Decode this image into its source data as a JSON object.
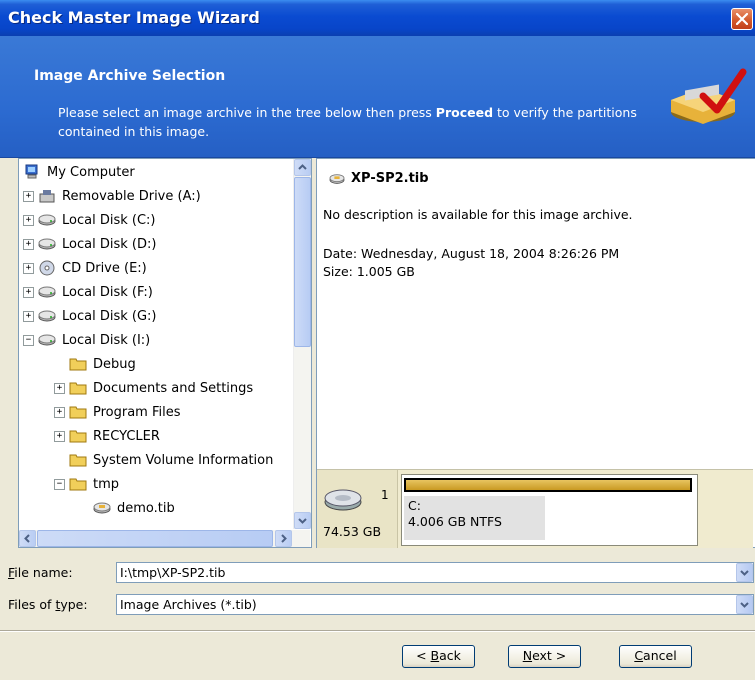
{
  "window": {
    "title": "Check Master Image Wizard"
  },
  "header": {
    "heading": "Image Archive Selection",
    "desc_pre": "Please select an image archive in the tree below then press ",
    "desc_bold": "Proceed",
    "desc_post": " to verify the partitions contained in this image."
  },
  "tree": {
    "items": [
      {
        "label": "My Computer",
        "icon": "computer-icon"
      },
      {
        "label": "Removable Drive (A:)",
        "icon": "removable-drive-icon",
        "expander": "+"
      },
      {
        "label": "Local Disk (C:)",
        "icon": "hard-disk-icon",
        "expander": "+"
      },
      {
        "label": "Local Disk (D:)",
        "icon": "hard-disk-icon",
        "expander": "+"
      },
      {
        "label": "CD Drive (E:)",
        "icon": "cd-drive-icon",
        "expander": "+"
      },
      {
        "label": "Local Disk (F:)",
        "icon": "hard-disk-icon",
        "expander": "+"
      },
      {
        "label": "Local Disk (G:)",
        "icon": "hard-disk-icon",
        "expander": "+"
      },
      {
        "label": "Local Disk (I:)",
        "icon": "hard-disk-icon",
        "expander": "−"
      },
      {
        "label": "Debug",
        "icon": "folder-icon"
      },
      {
        "label": "Documents and Settings",
        "icon": "folder-icon",
        "expander": "+"
      },
      {
        "label": "Program Files",
        "icon": "folder-icon",
        "expander": "+"
      },
      {
        "label": "RECYCLER",
        "icon": "folder-icon",
        "expander": "+"
      },
      {
        "label": "System Volume Information",
        "icon": "folder-icon"
      },
      {
        "label": "tmp",
        "icon": "folder-icon",
        "expander": "−"
      },
      {
        "label": "demo.tib",
        "icon": "image-archive-icon"
      }
    ]
  },
  "details": {
    "file_name": "XP-SP2.tib",
    "description": "No description is available for this image archive.",
    "date": "Date: Wednesday, August 18, 2004 8:26:26 PM",
    "size": "Size: 1.005 GB",
    "disk_number": "1",
    "disk_size": "74.53 GB",
    "partition_letter": "C:",
    "partition_info": "4.006 GB  NTFS"
  },
  "form": {
    "file_name_label_pre": "",
    "file_name_label_u": "F",
    "file_name_label_post": "ile name:",
    "file_name_value": "I:\\tmp\\XP-SP2.tib",
    "files_type_label_pre": "Files of ",
    "files_type_label_u": "t",
    "files_type_label_post": "ype:",
    "files_type_value": "Image Archives (*.tib)"
  },
  "buttons": {
    "back_pre": "< ",
    "back_u": "B",
    "back_post": "ack",
    "next_pre": "",
    "next_u": "N",
    "next_post": "ext >",
    "cancel_pre": "",
    "cancel_u": "C",
    "cancel_post": "ancel"
  }
}
